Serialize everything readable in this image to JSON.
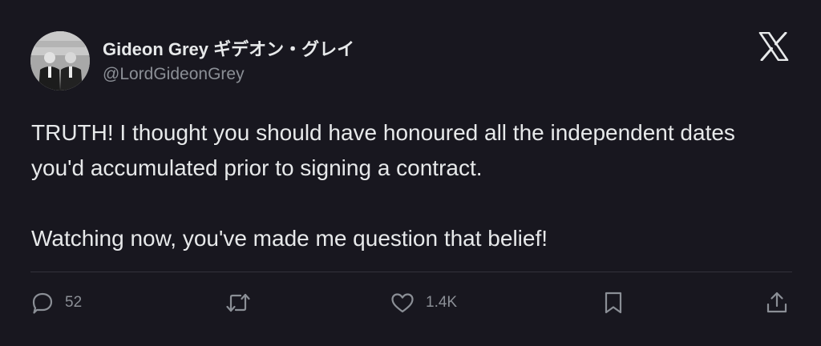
{
  "author": {
    "name": "Gideon Grey ギデオン・グレイ",
    "handle": "@LordGideonGrey",
    "avatar_icon": "profile-photo"
  },
  "platform": {
    "logo_icon": "x-logo-icon"
  },
  "tweet": {
    "paragraphs": [
      "TRUTH! I thought you should have honoured all the independent dates you'd accumulated prior to signing a contract.",
      "Watching now, you've made me question that belief!"
    ]
  },
  "actions": {
    "reply": {
      "icon": "reply-icon",
      "count": "52"
    },
    "retweet": {
      "icon": "retweet-icon",
      "count": ""
    },
    "like": {
      "icon": "heart-icon",
      "count": "1.4K"
    },
    "bookmark": {
      "icon": "bookmark-icon",
      "count": ""
    },
    "share": {
      "icon": "share-icon",
      "count": ""
    }
  },
  "colors": {
    "background": "#18171f",
    "text": "#e7e9ea",
    "muted": "#8b8f96",
    "divider": "#33323b"
  }
}
